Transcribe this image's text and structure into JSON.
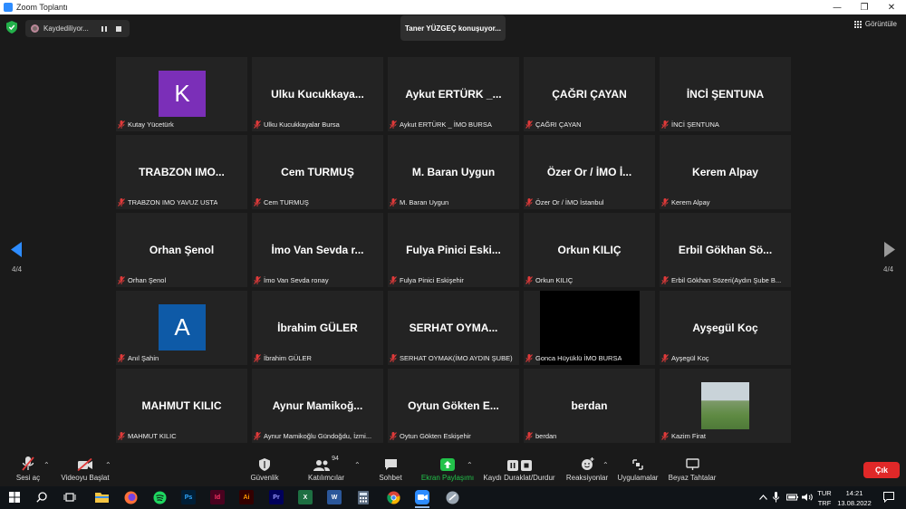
{
  "window": {
    "title": "Zoom Toplantı",
    "controls": [
      "—",
      "❐",
      "✕"
    ]
  },
  "topbar": {
    "recording_label": "Kaydediliyor...",
    "speaker_banner": "Taner YÜZGEÇ konuşuyor...",
    "view_label": "Görüntüle"
  },
  "pagination": {
    "left": "4/4",
    "right": "4/4"
  },
  "tiles": [
    {
      "name": "",
      "label": "Kutay Yücetürk",
      "avatar_letter": "K",
      "avatar_color": "#7b2fb8"
    },
    {
      "name": "Ulku Kucukkaya...",
      "label": "Ulku Kucukkayalar Bursa"
    },
    {
      "name": "Aykut ERTÜRK _...",
      "label": "Aykut ERTÜRK _ İMO BURSA"
    },
    {
      "name": "ÇAĞRI ÇAYAN",
      "label": "ÇAĞRI ÇAYAN"
    },
    {
      "name": "İNCİ ŞENTUNA",
      "label": "İNCİ ŞENTUNA"
    },
    {
      "name": "TRABZON IMO...",
      "label": "TRABZON IMO YAVUZ USTA"
    },
    {
      "name": "Cem TURMUŞ",
      "label": "Cem TURMUŞ"
    },
    {
      "name": "M. Baran Uygun",
      "label": "M. Baran Uygun"
    },
    {
      "name": "Özer Or / İMO İ...",
      "label": "Özer Or / İMO İstanbul"
    },
    {
      "name": "Kerem Alpay",
      "label": "Kerem Alpay"
    },
    {
      "name": "Orhan Şenol",
      "label": "Orhan Şenol"
    },
    {
      "name": "İmo Van Sevda r...",
      "label": "İmo Van Sevda ronay"
    },
    {
      "name": "Fulya Pinici Eski...",
      "label": "Fulya Pinici Eskişehir"
    },
    {
      "name": "Orkun KILIÇ",
      "label": "Orkun KILIÇ"
    },
    {
      "name": "Erbil Gökhan Sö...",
      "label": "Erbil Gökhan Sözeri(Aydın Şube B..."
    },
    {
      "name": "",
      "label": "Anıl Şahin",
      "avatar_letter": "A",
      "avatar_color": "#0e5aa7"
    },
    {
      "name": "İbrahim GÜLER",
      "label": "İbrahim GÜLER"
    },
    {
      "name": "SERHAT OYMA...",
      "label": "SERHAT OYMAK(İMO AYDIN ŞUBE)"
    },
    {
      "name": "",
      "label": "Gonca Hüyüklü İMO BURSA",
      "video": "black"
    },
    {
      "name": "Ayşegül Koç",
      "label": "Ayşegül Koç"
    },
    {
      "name": "MAHMUT KILIC",
      "label": "MAHMUT KILIC"
    },
    {
      "name": "Aynur Mamikoğ...",
      "label": "Aynur Mamikoğlu Gündoğdu, İzmi..."
    },
    {
      "name": "Oytun Gökten E...",
      "label": "Oytun Gökten Eskişehir"
    },
    {
      "name": "berdan",
      "label": "berdan"
    },
    {
      "name": "",
      "label": "Kazim Firat",
      "video": "field"
    }
  ],
  "toolbar": {
    "mute": "Sesi aç",
    "video": "Videoyu Başlat",
    "security": "Güvenlik",
    "participants": "Katılımcılar",
    "participant_count": "94",
    "chat": "Sohbet",
    "share": "Ekran Paylaşımı",
    "record": "Kaydı Duraklat/Durdur",
    "reactions": "Reaksiyonlar",
    "apps": "Uygulamalar",
    "whiteboard": "Beyaz Tahtalar",
    "exit": "Çık"
  },
  "taskbar": {
    "lang": "TUR",
    "layout": "TRF",
    "time": "14:21",
    "date": "13.08.2022",
    "apps": [
      {
        "name": "Ps",
        "color": "#31a8ff",
        "bg": "#001e36"
      },
      {
        "name": "Id",
        "color": "#ff3366",
        "bg": "#49021f"
      },
      {
        "name": "Ai",
        "color": "#ff9a00",
        "bg": "#330000"
      },
      {
        "name": "Pr",
        "color": "#9999ff",
        "bg": "#00005b"
      },
      {
        "name": "X",
        "color": "#ffffff",
        "bg": "#1d6f42"
      },
      {
        "name": "W",
        "color": "#ffffff",
        "bg": "#2b579a"
      }
    ]
  },
  "colors": {
    "accent_share": "#22c24a",
    "exit": "#e02828",
    "zoom_blue": "#2d8cff",
    "muted_red": "#e03a3a"
  }
}
